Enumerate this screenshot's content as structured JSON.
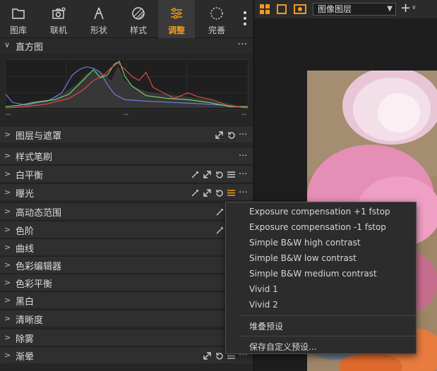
{
  "tabs": [
    {
      "label": "图库",
      "icon": "folder-icon"
    },
    {
      "label": "联机",
      "icon": "camera-icon"
    },
    {
      "label": "形状",
      "icon": "shape-icon"
    },
    {
      "label": "样式",
      "icon": "style-icon"
    },
    {
      "label": "调整",
      "icon": "sliders-icon",
      "active": true
    },
    {
      "label": "完善",
      "icon": "refine-icon"
    }
  ],
  "histogram": {
    "title": "直方图",
    "label_left": "--",
    "label_mid": "--",
    "label_right": "--",
    "colors": {
      "red": "#e24b4b",
      "green": "#6fd56f",
      "blue": "#6f7fe6",
      "gray": "#9a9a9a"
    }
  },
  "tools": [
    {
      "label": "图层与遮罩"
    },
    {
      "label": "样式笔刷"
    },
    {
      "label": "白平衡"
    },
    {
      "label": "曝光"
    },
    {
      "label": "高动态范围"
    },
    {
      "label": "色阶"
    },
    {
      "label": "曲线"
    },
    {
      "label": "色彩编辑器"
    },
    {
      "label": "色彩平衡"
    },
    {
      "label": "黑白"
    },
    {
      "label": "清晰度"
    },
    {
      "label": "除雾"
    },
    {
      "label": "渐晕"
    }
  ],
  "viewer": {
    "select_value": "图像图层",
    "accent": "#f39a1f"
  },
  "menu": {
    "items": [
      "Exposure compensation +1 fstop",
      "Exposure compensation -1 fstop",
      "Simple B&W high contrast",
      "Simple B&W low contrast",
      "Simple B&W medium contrast",
      "Vivid 1",
      "Vivid 2"
    ],
    "stack_presets": "堆叠预设",
    "save_preset": "保存自定义预设..."
  }
}
